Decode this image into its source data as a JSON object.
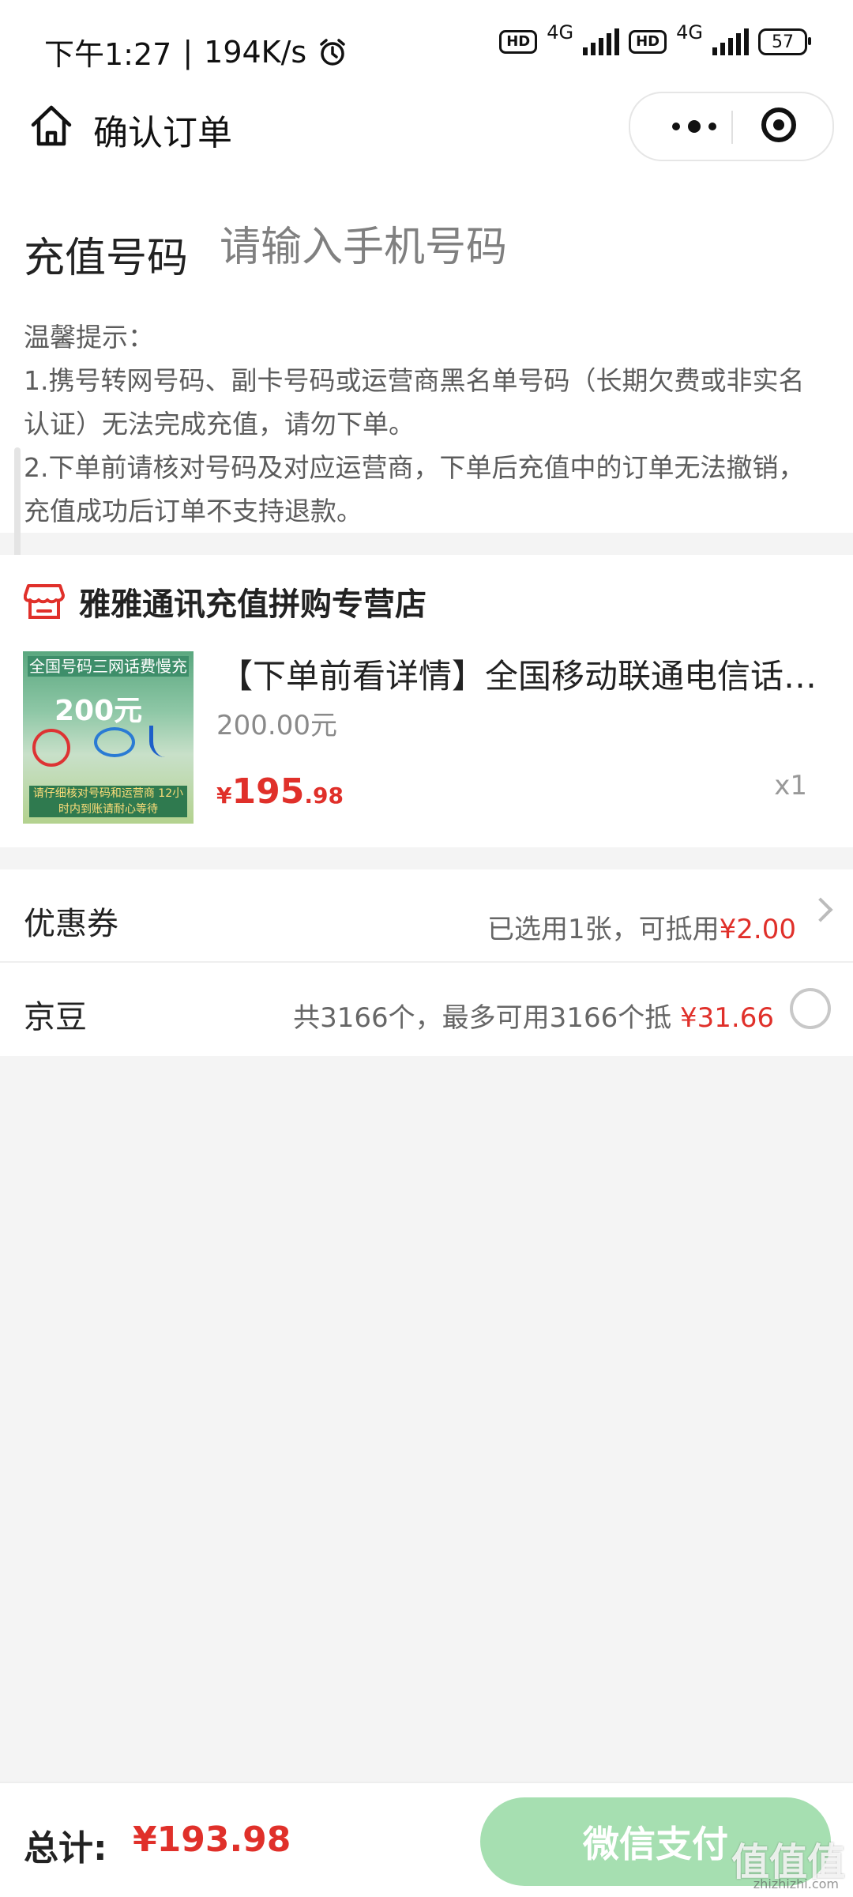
{
  "status_bar": {
    "time": "下午1:27",
    "speed": "194K/s",
    "network1": "4G",
    "network2": "4G",
    "hd_label": "HD",
    "battery": "57"
  },
  "nav": {
    "title": "确认订单"
  },
  "recharge": {
    "label": "充值号码",
    "placeholder": "请输入手机号码",
    "tips": [
      "温馨提示：",
      "1.携号转网号码、副卡号码或运营商黑名单号码（长期欠费或非实名认证）无法完成充值，请勿下单。",
      "2.下单前请核对号码及对应运营商，下单后充值中的订单无法撤销，充值成功后订单不支持退款。"
    ]
  },
  "shop": {
    "name": "雅雅通讯充值拼购专营店",
    "product": {
      "title": "【下单前看详情】全国移动联通电信话费充值",
      "subtitle": "200.00元",
      "price_symbol": "¥",
      "price_int": "195",
      "price_dec": ".98",
      "quantity": "x1",
      "image_text_top": "全国号码三网话费慢充",
      "image_text_amount": "200元",
      "image_text_bottom": "请仔细核对号码和运营商 12小时内到账请耐心等待"
    }
  },
  "options": {
    "coupon": {
      "label": "优惠券",
      "text": "已选用1张，可抵用",
      "amount": "¥2.00"
    },
    "jingdou": {
      "label": "京豆",
      "text": "共3166个，最多可用3166个抵",
      "amount": "¥31.66"
    }
  },
  "footer": {
    "total_label": "总计:",
    "total_value": "¥193.98",
    "pay_label": "微信支付",
    "watermark": "值值值",
    "watermark_sub": "zhizhizhi.com"
  },
  "colors": {
    "accent_red": "#e0302a",
    "pay_button": "#a6dfb1",
    "background": "#f4f4f4"
  }
}
